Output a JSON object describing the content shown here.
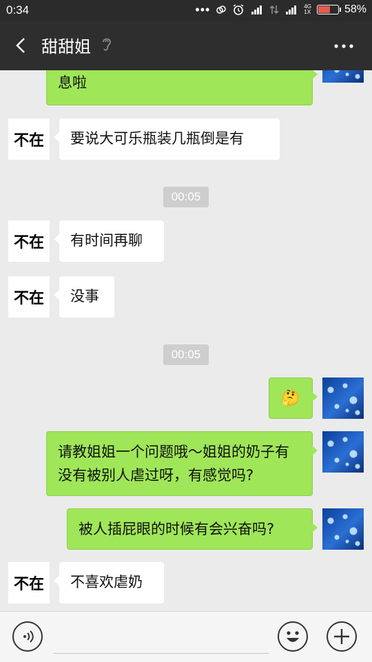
{
  "status_bar": {
    "time": "0:34",
    "network": "4G",
    "network_sub": "1X",
    "battery": "58%"
  },
  "header": {
    "title": "甜甜姐",
    "icons": [
      "back-icon",
      "ear-icon",
      "more-icon"
    ]
  },
  "contact_avatar_label": "不在",
  "messages": [
    {
      "side": "out",
      "text": "息啦"
    },
    {
      "side": "in",
      "text": "要说大可乐瓶装几瓶倒是有"
    },
    {
      "side": "time",
      "text": "00:05"
    },
    {
      "side": "in",
      "text": "有时间再聊"
    },
    {
      "side": "in",
      "text": "没事"
    },
    {
      "side": "time",
      "text": "00:05"
    },
    {
      "side": "out",
      "text": "🤔"
    },
    {
      "side": "out",
      "text": "请教姐姐一个问题哦～姐姐的奶子有没有被别人虐过呀，有感觉吗?"
    },
    {
      "side": "out",
      "text": "被人插屁眼的时候有会兴奋吗?"
    },
    {
      "side": "in",
      "text": "不喜欢虐奶"
    }
  ],
  "input_bar": {
    "icons": [
      "voice-icon",
      "emoji-icon",
      "plus-icon"
    ],
    "value": ""
  },
  "colors": {
    "header_bg": "#2e2e2e",
    "chat_bg": "#ebebeb",
    "out_bubble": "#9fe658",
    "in_bubble": "#ffffff",
    "timestamp_bg": "#cecece"
  }
}
